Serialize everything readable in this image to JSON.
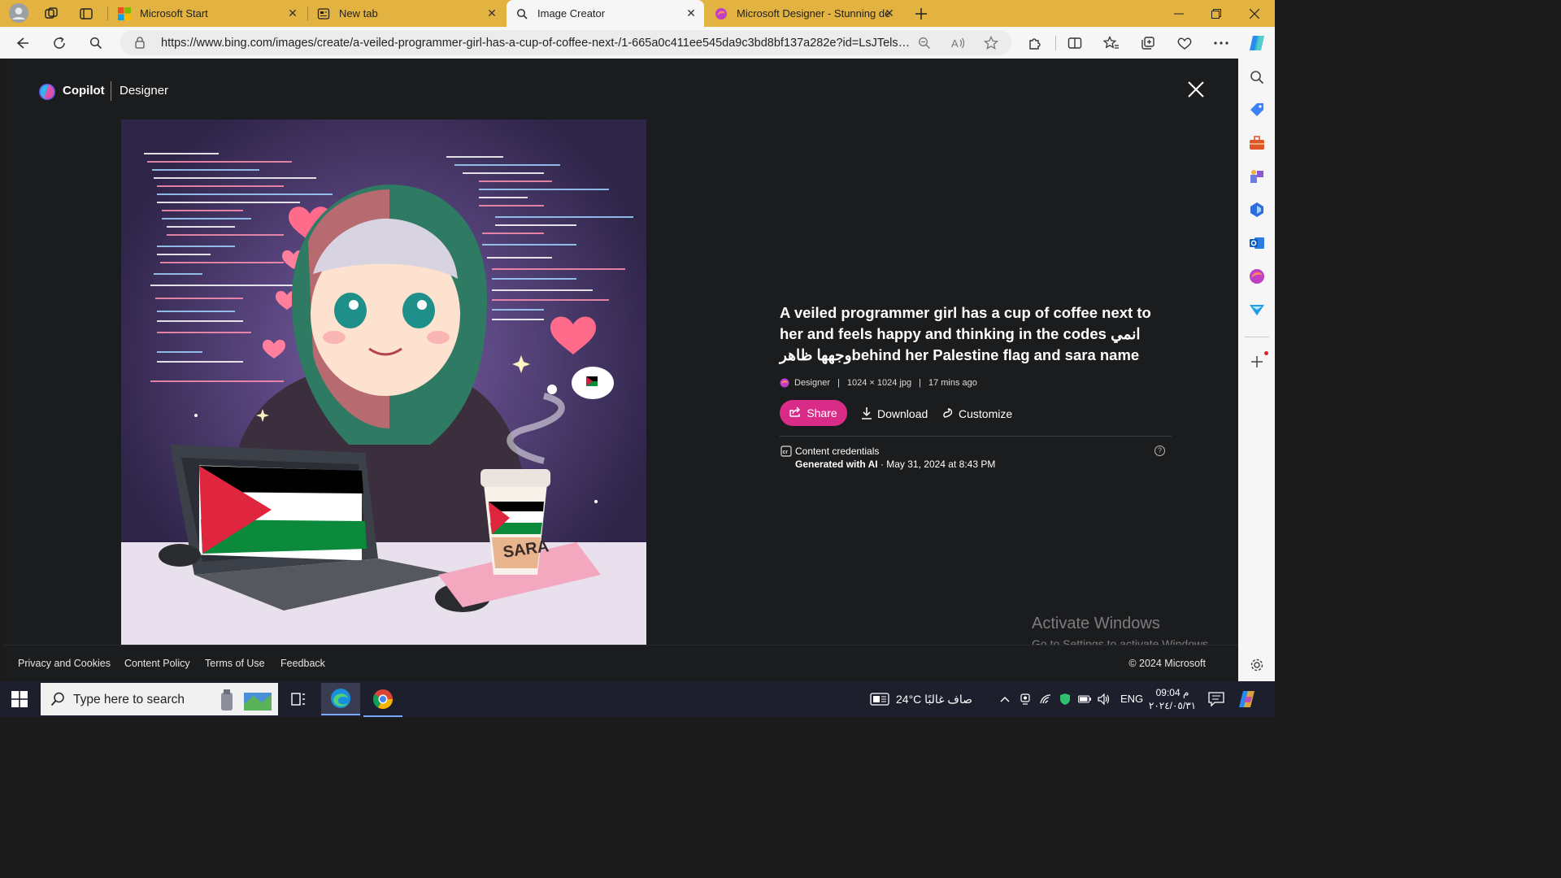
{
  "browser": {
    "tabs": [
      {
        "title": "Microsoft Start",
        "icon": "microsoft-logo-icon",
        "active": false
      },
      {
        "title": "New tab",
        "icon": "new-tab-page-icon",
        "active": false
      },
      {
        "title": "Image Creator",
        "icon": "search-icon",
        "active": true
      },
      {
        "title": "Microsoft Designer - Stunning de",
        "icon": "designer-icon",
        "active": false
      }
    ],
    "url": "https://www.bing.com/images/create/a-veiled-programmer-girl-has-a-cup-of-coffee-next-/1-665a0c411ee545da9c3bd8bf137a282e?id=LsJTelsE..."
  },
  "header": {
    "brand": "Copilot",
    "product": "Designer"
  },
  "image": {
    "laptop_text": "",
    "cup_text": "SARA"
  },
  "detail": {
    "title": "A veiled programmer girl has a cup of coffee next to her and feels happy and thinking in the codes انمي وجهها ظاهرbehind her Palestine flag and sara name",
    "source": "Designer",
    "dimensions": "1024 × 1024 jpg",
    "age": "17 mins ago",
    "share_label": "Share",
    "download_label": "Download",
    "customize_label": "Customize",
    "credentials_title": "Content credentials",
    "credentials_generated": "Generated with AI",
    "credentials_date": "· May 31, 2024 at 8:43 PM"
  },
  "watermark": {
    "line1": "Activate Windows",
    "line2": "Go to Settings to activate Windows."
  },
  "footer": {
    "links": [
      "Privacy and Cookies",
      "Content Policy",
      "Terms of Use",
      "Feedback"
    ],
    "copyright": "© 2024 Microsoft"
  },
  "taskbar": {
    "search_placeholder": "Type here to search",
    "weather": "24°C  صاف غالبًا",
    "language": "ENG",
    "time": "09:04 م",
    "date": "٢٠٢٤/٠٥/٣١"
  },
  "colors": {
    "accent": "#d92c88",
    "tabstrip": "#e3b341",
    "page_bg": "#1b1c1e"
  }
}
